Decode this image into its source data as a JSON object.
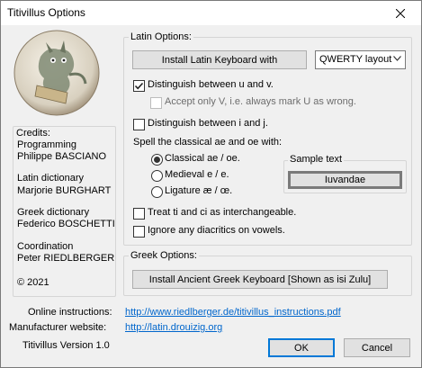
{
  "window": {
    "title": "Titivillus Options"
  },
  "credits": {
    "heading": "Credits:",
    "programming_role": "Programming",
    "programming_name": "Philippe BASCIANO",
    "latin_role": "Latin dictionary",
    "latin_name": "Marjorie BURGHART",
    "greek_role": "Greek dictionary",
    "greek_name": "Federico BOSCHETTI",
    "coord_role": "Coordination",
    "coord_name": "Peter RIEDLBERGER",
    "copyright": "© 2021"
  },
  "latin": {
    "heading": "Latin Options:",
    "install_button": "Install Latin Keyboard with",
    "layout_select": "QWERTY layout",
    "distinguish_uv": {
      "label": "Distinguish between u and v.",
      "checked": true
    },
    "accept_v": {
      "label": "Accept only V, i.e. always mark U as wrong.",
      "checked": false,
      "disabled": true
    },
    "distinguish_ij": {
      "label": "Distinguish between i and j.",
      "checked": false
    },
    "spell_heading": "Spell the classical ae and oe with:",
    "spell_options": [
      {
        "label": "Classical ae / oe.",
        "selected": true
      },
      {
        "label": "Medieval e / e.",
        "selected": false
      },
      {
        "label": "Ligature æ / œ.",
        "selected": false
      }
    ],
    "sample_heading": "Sample text",
    "sample_value": "Iuvandae",
    "ti_ci": {
      "label": "Treat ti and ci as interchangeable.",
      "checked": false
    },
    "diacritics": {
      "label": "Ignore any diacritics on vowels.",
      "checked": false
    }
  },
  "greek": {
    "heading": "Greek Options:",
    "install_button": "Install Ancient Greek Keyboard [Shown as isi Zulu]"
  },
  "footer": {
    "online_label": "Online instructions:",
    "online_url": "http://www.riedlberger.de/titivillus_instructions.pdf",
    "manufacturer_label": "Manufacturer website:",
    "manufacturer_url": "http://latin.drouizig.org",
    "version": "Titivillus Version 1.0",
    "ok": "OK",
    "cancel": "Cancel"
  }
}
